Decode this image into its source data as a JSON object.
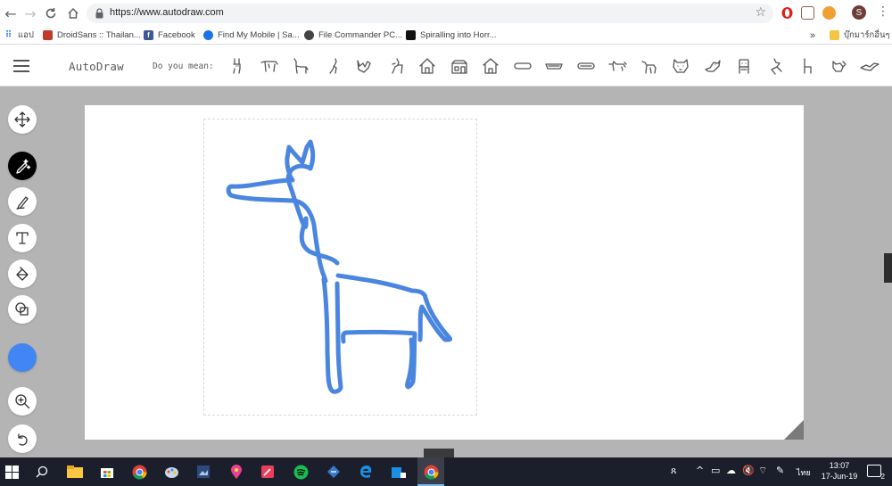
{
  "browser": {
    "url": "https://www.autodraw.com",
    "profile_initial": "S",
    "bookmarks": [
      {
        "label": "แอป",
        "color": "#4285f4"
      },
      {
        "label": "DroidSans :: Thailan...",
        "color": "#c0392b"
      },
      {
        "label": "Facebook",
        "color": "#3b5998"
      },
      {
        "label": "Find My Mobile | Sa...",
        "color": "#1a73e8"
      },
      {
        "label": "File Commander PC...",
        "color": "#444444"
      },
      {
        "label": "Spiralling into Horr...",
        "color": "#111111"
      },
      {
        "label": "บุ๊กมาร์กอื่นๆ",
        "color": "#f4c542"
      }
    ],
    "more_bookmarks": "»"
  },
  "autodraw": {
    "logo": "AutoDraw",
    "suggest_label": "Do you mean:",
    "suggestions": [
      "rabbit-icon",
      "horse-icon",
      "llama-icon",
      "giraffe-small-icon",
      "squirrel-icon",
      "deer-icon",
      "house-icon",
      "barn-icon",
      "birdhouse-icon",
      "hotdog-icon",
      "tray-icon",
      "dish-icon",
      "dog-icon",
      "sheep-icon",
      "dog-face-icon",
      "bird-icon",
      "robot-icon",
      "deer-standing-icon",
      "chair-icon",
      "cat-icon",
      "bird-flying-icon"
    ],
    "tools": [
      "move-tool",
      "autodraw-tool",
      "draw-tool",
      "text-tool",
      "fill-tool",
      "shape-tool"
    ],
    "active_tool": "autodraw-tool",
    "stroke_color": "#4a86e0",
    "fill_color": "#4285f4"
  },
  "taskbar": {
    "time": "13:07",
    "date": "17-Jun-19",
    "language": "ไทย",
    "notifications": "2"
  }
}
